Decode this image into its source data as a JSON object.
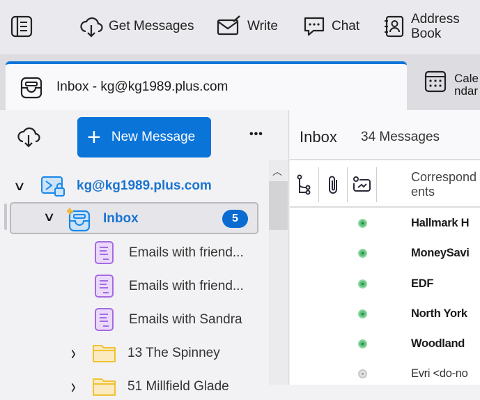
{
  "toolbar": {
    "get_messages": "Get Messages",
    "write": "Write",
    "chat": "Chat",
    "address_book": "Address Book"
  },
  "tabs": [
    {
      "label": "Inbox - kg@kg1989.plus.com"
    },
    {
      "label": "Calendar"
    }
  ],
  "folder_pane": {
    "new_message": "New Message",
    "more": "•••",
    "account": "kg@kg1989.plus.com",
    "inbox": {
      "label": "Inbox",
      "unread": "5"
    },
    "folders": [
      "Emails with friend...",
      "Emails with friend...",
      "Emails with Sandra",
      "13 The Spinney",
      "51 Millfield Glade"
    ]
  },
  "message_pane": {
    "title": "Inbox",
    "count": "34 Messages",
    "column_correspondents": "Correspondents",
    "messages": [
      {
        "sender": "Hallmark H",
        "unread": true
      },
      {
        "sender": "MoneySavi",
        "unread": true
      },
      {
        "sender": "EDF",
        "unread": true
      },
      {
        "sender": "North York",
        "unread": true
      },
      {
        "sender": "Woodland",
        "unread": true
      },
      {
        "sender": "Evri <do-no",
        "unread": false
      }
    ]
  },
  "colors": {
    "accent": "#0a74d9",
    "unread_dot": "#5cc07a",
    "folder_icon": "#f0c232",
    "saved_search": "#a66be0"
  }
}
